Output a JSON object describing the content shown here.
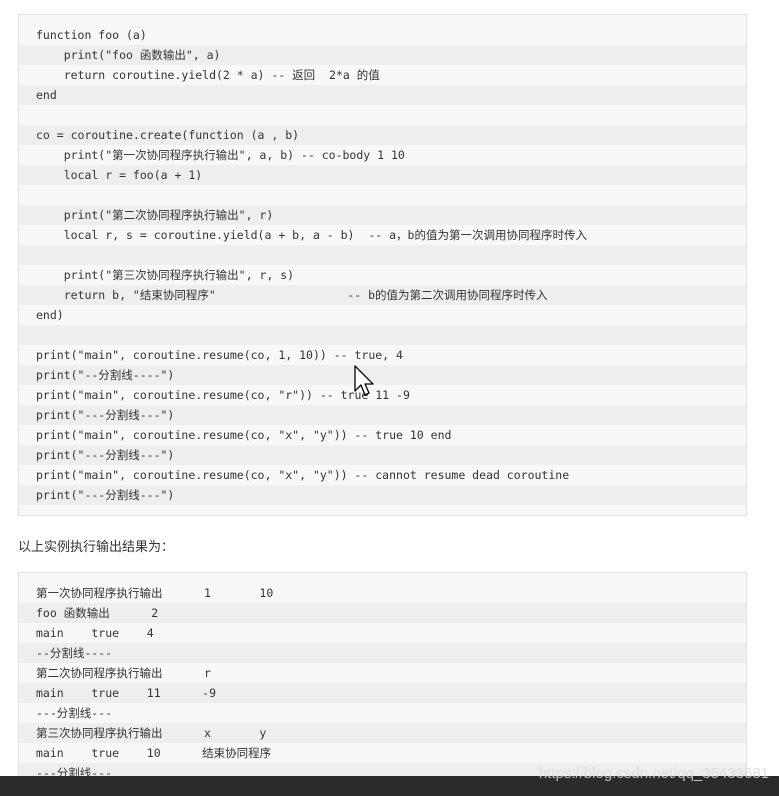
{
  "code_block_1": {
    "lines": [
      "function foo (a)",
      "    print(\"foo 函数输出\", a)",
      "    return coroutine.yield(2 * a) -- 返回  2*a 的值",
      "end",
      "",
      "co = coroutine.create(function (a , b)",
      "    print(\"第一次协同程序执行输出\", a, b) -- co-body 1 10",
      "    local r = foo(a + 1)",
      "",
      "    print(\"第二次协同程序执行输出\", r)",
      "    local r, s = coroutine.yield(a + b, a - b)  -- a，b的值为第一次调用协同程序时传入",
      "",
      "    print(\"第三次协同程序执行输出\", r, s)",
      "    return b, \"结束协同程序\"                   -- b的值为第二次调用协同程序时传入",
      "end)",
      "",
      "print(\"main\", coroutine.resume(co, 1, 10)) -- true, 4",
      "print(\"--分割线----\")",
      "print(\"main\", coroutine.resume(co, \"r\")) -- true 11 -9",
      "print(\"---分割线---\")",
      "print(\"main\", coroutine.resume(co, \"x\", \"y\")) -- true 10 end",
      "print(\"---分割线---\")",
      "print(\"main\", coroutine.resume(co, \"x\", \"y\")) -- cannot resume dead coroutine",
      "print(\"---分割线---\")"
    ]
  },
  "caption": "以上实例执行输出结果为：",
  "code_block_2": {
    "lines": [
      "第一次协同程序执行输出      1       10",
      "foo 函数输出      2",
      "main    true    4",
      "--分割线----",
      "第二次协同程序执行输出      r",
      "main    true    11      -9",
      "---分割线---",
      "第三次协同程序执行输出      x       y",
      "main    true    10      结束协同程序",
      "---分割线---"
    ]
  },
  "watermark": "https://blog.csdn.net/qq_35433681",
  "icons": {
    "cursor": "mouse-pointer-icon"
  }
}
